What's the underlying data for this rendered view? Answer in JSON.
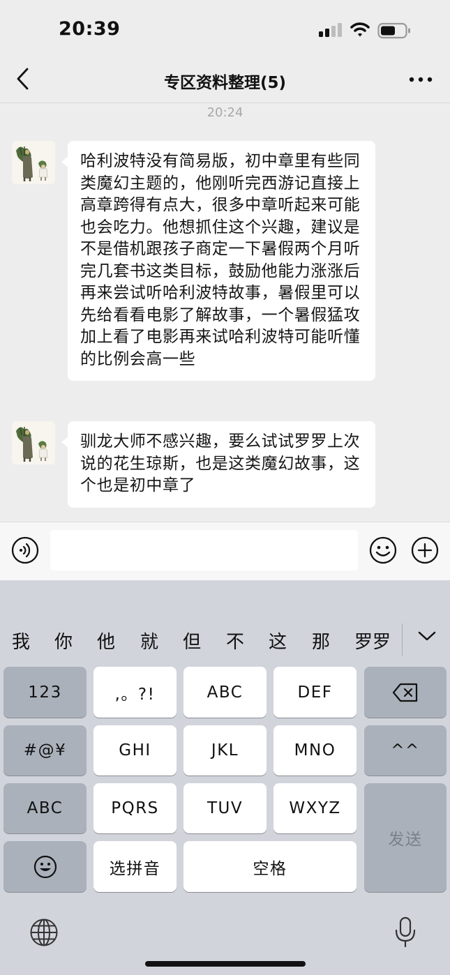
{
  "status_bar": {
    "time": "20:39"
  },
  "header": {
    "title": "专区资料整理(5)"
  },
  "chat": {
    "timestamp": "20:24",
    "messages": [
      {
        "text": "哈利波特没有简易版，初中章里有些同类魔幻主题的，他刚听完西游记直接上高章跨得有点大，很多中章听起来可能也会吃力。他想抓住这个兴趣，建议是不是借机跟孩子商定一下暑假两个月听完几套书这类目标，鼓励他能力涨涨后再来尝试听哈利波特故事，暑假里可以先给看看电影了解故事，一个暑假猛攻加上看了电影再来试哈利波特可能听懂的比例会高一些"
      },
      {
        "text": "驯龙大师不感兴趣，要么试试罗罗上次说的花生琼斯，也是这类魔幻故事，这个也是初中章了"
      }
    ]
  },
  "input": {
    "value": ""
  },
  "keyboard": {
    "candidates": [
      "我",
      "你",
      "他",
      "就",
      "但",
      "不",
      "这",
      "那",
      "罗罗"
    ],
    "keys": {
      "num": "123",
      "punct": ",。?!",
      "abc1": "ABC",
      "def": "DEF",
      "symbols": "#@¥",
      "ghi": "GHI",
      "jkl": "JKL",
      "mno": "MNO",
      "caret": "^^",
      "abc2": "ABC",
      "pqrs": "PQRS",
      "tuv": "TUV",
      "wxyz": "WXYZ",
      "pinyin": "选拼音",
      "space": "空格",
      "send": "发送"
    }
  },
  "colors": {
    "background": "#ededed",
    "keyboard": "#d1d4db",
    "bubble": "#ffffff"
  }
}
